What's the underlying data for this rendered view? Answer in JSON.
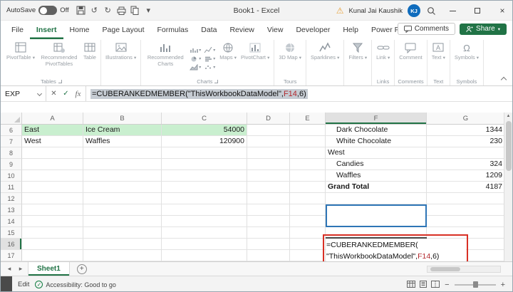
{
  "titlebar": {
    "autosave_label": "AutoSave",
    "autosave_state": "Off",
    "quick_access_icons": [
      "save",
      "undo",
      "redo",
      "print",
      "copy",
      "customize"
    ],
    "title": "Book1 - Excel",
    "user_name": "Kunal Jai Kaushik",
    "avatar_initials": "KJ"
  },
  "ribbon": {
    "tabs": [
      {
        "label": "File"
      },
      {
        "label": "Insert",
        "active": true
      },
      {
        "label": "Home"
      },
      {
        "label": "Page Layout"
      },
      {
        "label": "Formulas"
      },
      {
        "label": "Data"
      },
      {
        "label": "Review"
      },
      {
        "label": "View"
      },
      {
        "label": "Developer"
      },
      {
        "label": "Help"
      },
      {
        "label": "Power Pivot"
      }
    ],
    "comments_label": "Comments",
    "share_label": "Share",
    "groups": [
      {
        "label": "Tables",
        "launcher": true,
        "items": [
          {
            "label": "PivotTable",
            "icon": "pivottable",
            "chevron": true
          },
          {
            "label": "Recommended PivotTables",
            "icon": "recommended-pivottables"
          },
          {
            "label": "Table",
            "icon": "table"
          }
        ]
      },
      {
        "label": "",
        "items": [
          {
            "label": "Illustrations",
            "icon": "illustrations",
            "chevron": true
          }
        ]
      },
      {
        "label": "Charts",
        "launcher": true,
        "items": [
          {
            "label": "Recommended Charts",
            "icon": "recommended-charts"
          },
          {
            "type": "minigrid"
          },
          {
            "label": "Maps",
            "icon": "maps",
            "chevron": true
          },
          {
            "label": "PivotChart",
            "icon": "pivotchart",
            "chevron": true
          }
        ]
      },
      {
        "label": "Tours",
        "items": [
          {
            "label": "3D Map",
            "icon": "3d-map",
            "chevron": true
          }
        ]
      },
      {
        "label": "",
        "items": [
          {
            "label": "Sparklines",
            "icon": "sparklines",
            "chevron": true
          }
        ]
      },
      {
        "label": "",
        "items": [
          {
            "label": "Filters",
            "icon": "filters",
            "chevron": true
          }
        ]
      },
      {
        "label": "Links",
        "items": [
          {
            "label": "Link",
            "icon": "link",
            "chevron": true
          }
        ]
      },
      {
        "label": "Comments",
        "items": [
          {
            "label": "Comment",
            "icon": "comment"
          }
        ]
      },
      {
        "label": "Text",
        "items": [
          {
            "label": "Text",
            "icon": "text-box",
            "chevron": true
          }
        ]
      },
      {
        "label": "Symbols",
        "items": [
          {
            "label": "Symbols",
            "icon": "symbols",
            "chevron": true
          }
        ]
      }
    ]
  },
  "formula_bar": {
    "name_box": "EXP",
    "prefix": "=CUBERANKEDMEMBER(\"ThisWorkbookDataModel\",",
    "ref": "F14",
    "suffix": ",6)"
  },
  "grid": {
    "columns": [
      "A",
      "B",
      "C",
      "D",
      "E",
      "F",
      "G"
    ],
    "rows": [
      {
        "n": 6,
        "cells": {
          "A": "East",
          "B": "Ice Cream",
          "C": "54000",
          "F": "Dark Chocolate",
          "G": "1344"
        },
        "fillABC": true,
        "F_indent": true
      },
      {
        "n": 7,
        "cells": {
          "A": "West",
          "B": "Waffles",
          "C": "120900",
          "F": "White Chocolate",
          "G": "230"
        },
        "F_indent": true
      },
      {
        "n": 8,
        "cells": {
          "F": "West"
        }
      },
      {
        "n": 9,
        "cells": {
          "F": "Candies",
          "G": "324"
        },
        "F_indent": true
      },
      {
        "n": 10,
        "cells": {
          "F": "Waffles",
          "G": "1209"
        },
        "F_indent": true
      },
      {
        "n": 11,
        "cells": {
          "F": "Grand Total",
          "G": "4187"
        },
        "F_bold": true
      },
      {
        "n": 12,
        "cells": {}
      },
      {
        "n": 13,
        "cells": {}
      },
      {
        "n": 14,
        "cells": {}
      },
      {
        "n": 15,
        "cells": {}
      },
      {
        "n": 16,
        "cells": {}
      },
      {
        "n": 17,
        "cells": {}
      }
    ],
    "active_column": "F",
    "active_row": 16
  },
  "cell_edit": {
    "line1": "=CUBERANKEDMEMBER(",
    "line2_prefix": "\"ThisWorkbookDataModel\",",
    "line2_ref": "F14",
    "line2_suffix": ",6)"
  },
  "sheet_tabs": {
    "tabs": [
      "Sheet1"
    ],
    "add_label": "+"
  },
  "status_bar": {
    "mode": "Edit",
    "accessibility": "Accessibility: Good to go",
    "view_icons": [
      "normal-view",
      "page-layout-view",
      "page-break-view"
    ],
    "zoom_minus": "−",
    "zoom_plus": "+"
  },
  "colors": {
    "accent_green": "#217346",
    "selection_blue": "#2e75b6",
    "annotation_red": "#d83025",
    "row_fill_green": "#c9efcf",
    "ref_red": "#b3282d"
  }
}
